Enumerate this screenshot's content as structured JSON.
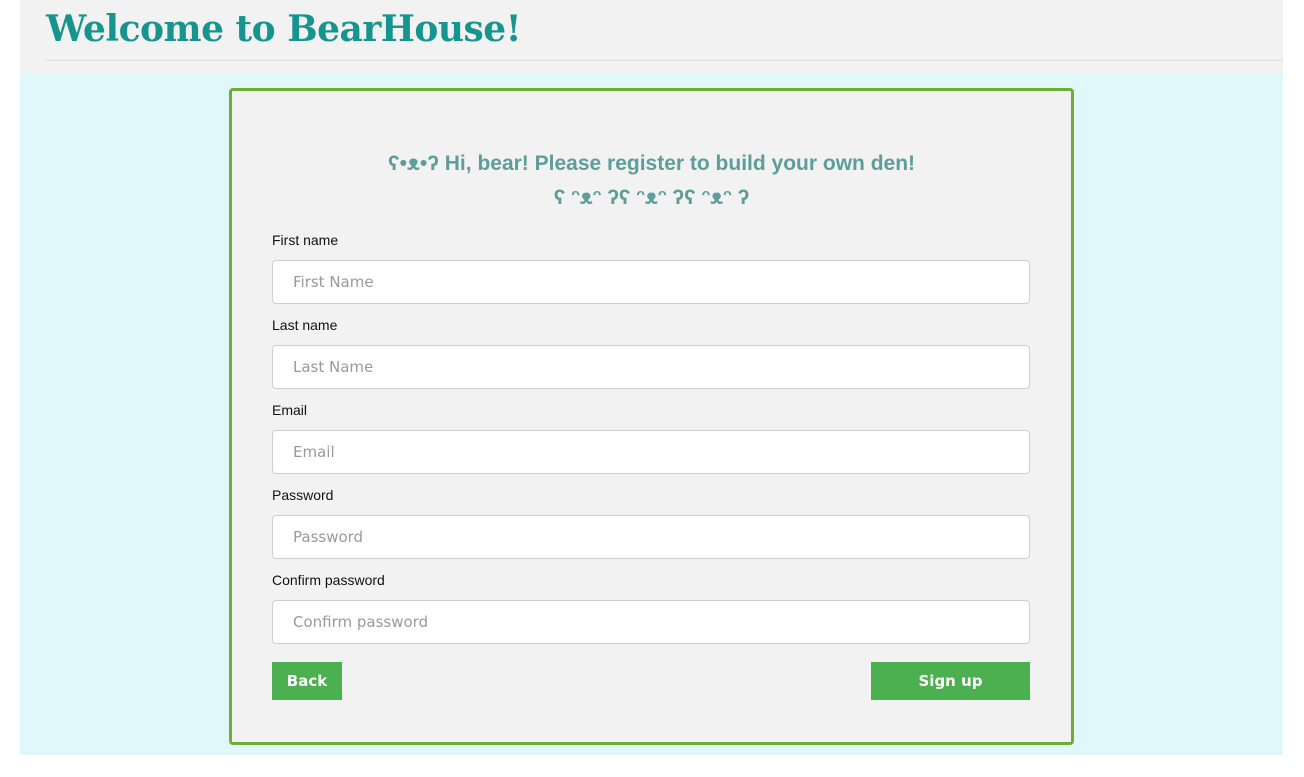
{
  "header": {
    "title": "Welcome to BearHouse!"
  },
  "form": {
    "greeting_line1": "ʕ•ᴥ•ʔ Hi, bear! Please register to build your own den!",
    "greeting_line2": "ʕ ᵔᴥᵔ ʔʕ ᵔᴥᵔ ʔʕ ᵔᴥᵔ ʔ",
    "fields": [
      {
        "label": "First name",
        "placeholder": "First Name",
        "value": ""
      },
      {
        "label": "Last name",
        "placeholder": "Last Name",
        "value": ""
      },
      {
        "label": "Email",
        "placeholder": "Email",
        "value": ""
      },
      {
        "label": "Password",
        "placeholder": "Password",
        "value": ""
      },
      {
        "label": "Confirm password",
        "placeholder": "Confirm password",
        "value": ""
      }
    ],
    "back_label": "Back",
    "signup_label": "Sign up"
  },
  "colors": {
    "title": "#16958e",
    "card_border": "#70ad35",
    "button": "#4caf50",
    "page_background": "#e0f7fc"
  }
}
